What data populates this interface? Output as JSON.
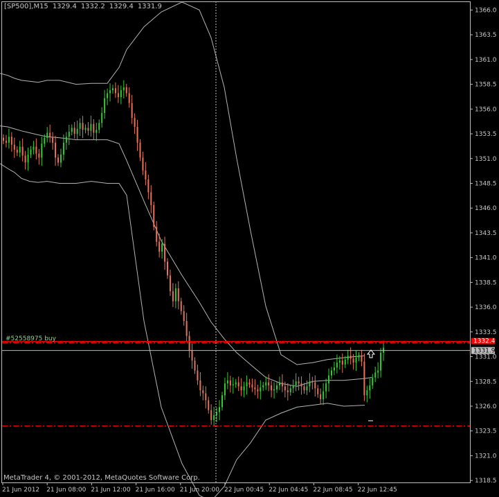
{
  "window": {
    "symbol_header": "[SP500],M15",
    "ohlc": [
      "1329.4",
      "1332.2",
      "1329.4",
      "1331.9"
    ],
    "copyright": "MetaTrader 4, © 2001-2012, MetaQuotes Software Corp."
  },
  "colors": {
    "background": "#000000",
    "axis": "#c0c0c0",
    "grid_text": "#c8c8c8",
    "bull_candle": "#32cd32",
    "bear_candle": "#e8735a",
    "band_line": "#b4b4b4",
    "order_line": "#ff0000",
    "bid_line": "#9ad09a",
    "bid_box": "#c0c0c0",
    "ask_box": "#ff0000"
  },
  "order": {
    "label": "#52558975 buy",
    "bid_value": "1331.9",
    "ask_value": "1332.4"
  },
  "chart_data": {
    "type": "line",
    "price_axis": {
      "ticks": [
        "1366.0",
        "1363.5",
        "1361.0",
        "1358.5",
        "1356.0",
        "1353.5",
        "1351.0",
        "1348.5",
        "1346.0",
        "1343.5",
        "1341.0",
        "1338.5",
        "1336.0",
        "1333.5",
        "1331.0",
        "1328.5",
        "1326.0",
        "1323.5",
        "1321.0",
        "1318.5"
      ],
      "ylim": [
        1318.3,
        1366.8
      ]
    },
    "time_axis": {
      "ticks": [
        "21 Jun 2012",
        "21 Jun 08:00",
        "21 Jun 12:00",
        "21 Jun 16:00",
        "21 Jun 20:00",
        "22 Jun 00:45",
        "22 Jun 04:45",
        "22 Jun 08:45",
        "22 Jun 12:45"
      ]
    },
    "series": [
      {
        "name": "SP500 M15",
        "closes": [
          1352.8,
          1352.6,
          1353.2,
          1352.4,
          1351.9,
          1351.6,
          1352.2,
          1351.3,
          1350.6,
          1351.4,
          1351.9,
          1352.2,
          1351.5,
          1351.1,
          1352.5,
          1353.1,
          1353.6,
          1353.2,
          1352.6,
          1351.1,
          1350.6,
          1351.4,
          1352.6,
          1353.2,
          1353.7,
          1354.1,
          1353.5,
          1354.0,
          1354.6,
          1353.9,
          1354.1,
          1353.8,
          1354.5,
          1353.6,
          1353.9,
          1354.6,
          1355.6,
          1357.1,
          1357.6,
          1357.9,
          1358.1,
          1357.6,
          1357.2,
          1357.9,
          1358.2,
          1357.6,
          1356.6,
          1355.1,
          1354.2,
          1352.6,
          1351.1,
          1349.8,
          1348.9,
          1347.6,
          1346.3,
          1344.1,
          1342.6,
          1341.6,
          1342.4,
          1340.6,
          1339.2,
          1337.6,
          1336.6,
          1337.9,
          1336.6,
          1335.6,
          1334.6,
          1333.1,
          1331.6,
          1330.6,
          1329.6,
          1328.6,
          1327.6,
          1327.3,
          1326.6,
          1325.6,
          1324.6,
          1325.1,
          1325.4,
          1325.9,
          1327.1,
          1328.3,
          1328.6,
          1328.1,
          1328.2,
          1328.4,
          1328.0,
          1327.6,
          1328.0,
          1328.4,
          1328.2,
          1327.9,
          1327.7,
          1327.5,
          1327.9,
          1328.1,
          1328.4,
          1328.1,
          1327.6,
          1327.7,
          1328.1,
          1328.4,
          1328.0,
          1327.6,
          1327.4,
          1327.8,
          1328.1,
          1328.5,
          1328.3,
          1328.0,
          1327.6,
          1328.0,
          1328.5,
          1328.4,
          1327.8,
          1327.2,
          1326.7,
          1327.5,
          1328.3,
          1329.1,
          1329.6,
          1329.9,
          1330.4,
          1330.6,
          1330.2,
          1330.7,
          1331.1,
          1330.8,
          1330.4,
          1330.9,
          1331.1,
          1330.5,
          1327.1,
          1327.6,
          1328.1,
          1328.9,
          1329.4,
          1329.6,
          1331.4,
          1331.9
        ],
        "values": [
          {
            "x": "21 Jun 2012",
            "y": 1352.8
          },
          {
            "x": "21 Jun 08:00",
            "y": 1352.6
          },
          {
            "x": "21 Jun 12:00",
            "y": 1358.1
          },
          {
            "x": "21 Jun 16:00",
            "y": 1344.1
          },
          {
            "x": "21 Jun 20:00",
            "y": 1326.6
          },
          {
            "x": "22 Jun 00:45",
            "y": 1328.1
          },
          {
            "x": "22 Jun 04:45",
            "y": 1327.6
          },
          {
            "x": "22 Jun 08:45",
            "y": 1330.9
          },
          {
            "x": "22 Jun 12:45",
            "y": 1331.9
          }
        ]
      },
      {
        "name": "band_upper",
        "values": [
          1359.6,
          1359.4,
          1359.1,
          1358.9,
          1358.8,
          1358.7,
          1358.9,
          1358.9,
          1358.5,
          1358.6,
          1358.6,
          1360.2,
          1362.0,
          1364.3,
          1365.8,
          1366.8,
          1366.0,
          1363.2,
          1358.2,
          1351.0,
          1343.7,
          1336.1,
          1331.2,
          1330.2,
          1330.4,
          1330.7,
          1330.9,
          1331.1
        ],
        "x": [
          0,
          11,
          21,
          31,
          43,
          55,
          68,
          86,
          110,
          132,
          155,
          172,
          183,
          208,
          233,
          263,
          288,
          305,
          324,
          342,
          362,
          384,
          406,
          429,
          452,
          473,
          497,
          527
        ]
      },
      {
        "name": "band_middle",
        "values": [
          1354.3,
          1354.2,
          1354.0,
          1353.8,
          1353.6,
          1353.4,
          1353.2,
          1353.1,
          1352.9,
          1352.9,
          1352.9,
          1352.5,
          1350.8,
          1346.7,
          1342.7,
          1339.2,
          1336.5,
          1334.5,
          1332.8,
          1331.4,
          1330.2,
          1328.9,
          1328.3,
          1328.0,
          1328.5,
          1328.6,
          1328.6,
          1328.8,
          1328.9
        ],
        "x": [
          0,
          11,
          21,
          31,
          43,
          55,
          68,
          86,
          110,
          132,
          155,
          172,
          183,
          208,
          233,
          263,
          288,
          305,
          324,
          342,
          362,
          384,
          406,
          429,
          452,
          473,
          497,
          527,
          537
        ]
      },
      {
        "name": "band_lower",
        "values": [
          1350.5,
          1350.0,
          1349.6,
          1349.0,
          1348.7,
          1348.6,
          1348.7,
          1348.5,
          1348.5,
          1348.7,
          1348.5,
          1348.5,
          1347.3,
          1334.6,
          1325.9,
          1320.2,
          1317.0,
          1316.4,
          1317.9,
          1320.6,
          1322.3,
          1324.6,
          1325.3,
          1325.9,
          1326.1,
          1326.3,
          1326.0,
          1326.1
        ],
        "x": [
          0,
          11,
          21,
          31,
          43,
          55,
          68,
          86,
          110,
          132,
          155,
          172,
          183,
          208,
          233,
          263,
          288,
          305,
          324,
          342,
          362,
          384,
          406,
          429,
          452,
          473,
          497,
          527
        ]
      }
    ],
    "levels": {
      "order_open": 1332.4,
      "bid": 1331.9,
      "stop_loss": 1324.0
    },
    "grid": false
  }
}
